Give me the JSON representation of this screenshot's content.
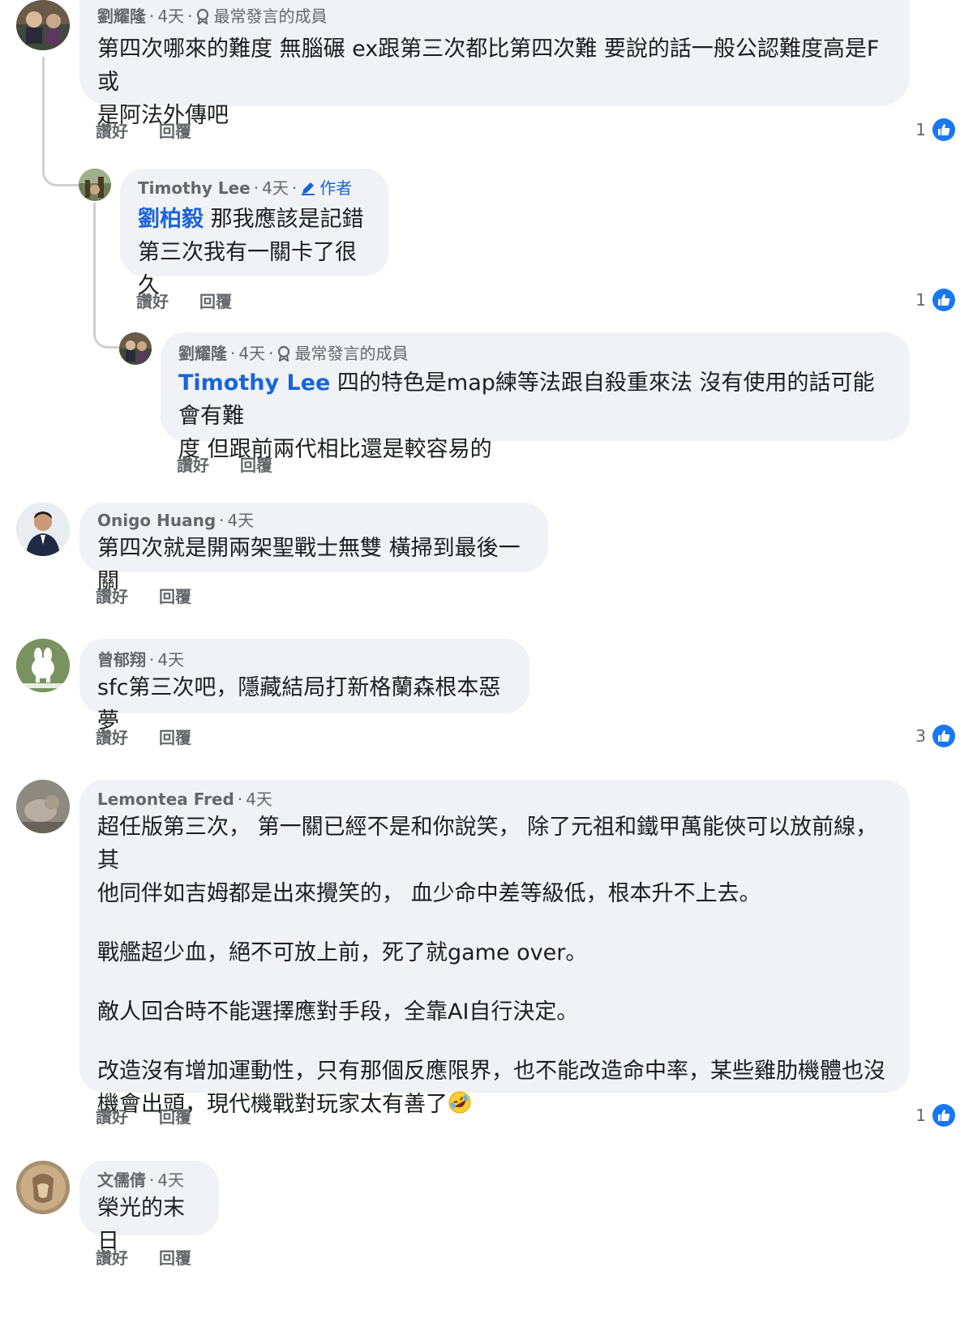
{
  "like_label": "讚好",
  "reply_label": "回覆",
  "comments": [
    {
      "name": "劉耀隆",
      "time": "4天",
      "badge": "最常發言的成員",
      "text_lines": [
        "第四次哪來的難度 無腦碾 ex跟第三次都比第四次難 要說的話一般公認難度高是F或",
        "是阿法外傳吧"
      ],
      "likes": "1"
    },
    {
      "name": "Timothy Lee",
      "time": "4天",
      "badge": "作者",
      "mention": "劉柏毅",
      "text_after_mention": " 那我應該是記錯",
      "text_line2": "第三次我有一關卡了很久",
      "likes": "1"
    },
    {
      "name": "劉耀隆",
      "time": "4天",
      "badge": "最常發言的成員",
      "mention": "Timothy Lee",
      "text_after_mention": " 四的特色是map練等法跟自殺重來法 沒有使用的話可能會有難",
      "text_line2": "度 但跟前兩代相比還是較容易的"
    },
    {
      "name": "Onigo Huang",
      "time": "4天",
      "text": "第四次就是開兩架聖戰士無雙 橫掃到最後一關"
    },
    {
      "name": "曾郁翔",
      "time": "4天",
      "text": "sfc第三次吧，隱藏結局打新格蘭森根本惡夢",
      "likes": "3"
    },
    {
      "name": "Lemontea Fred",
      "time": "4天",
      "paragraphs": [
        [
          "超任版第三次， 第一關已經不是和你說笑， 除了元祖和鐵甲萬能俠可以放前線， 其",
          "他同伴如吉姆都是出來攪笑的， 血少命中差等級低，根本升不上去。"
        ],
        [
          "戰艦超少血，絕不可放上前，死了就game over。"
        ],
        [
          "敵人回合時不能選擇應對手段，全靠AI自行決定。"
        ],
        [
          "改造沒有增加運動性，只有那個反應限界，也不能改造命中率，某些雞肋機體也沒",
          "機會出頭，現代機戰對玩家太有善了"
        ]
      ],
      "emoji": "rolling-on-floor-laughing-emoji",
      "likes": "1"
    },
    {
      "name": "文儒倩",
      "time": "4天",
      "text": "榮光的末日"
    }
  ],
  "icons": {
    "top_fan": "top-fan-badge-icon",
    "author": "author-pencil-icon",
    "like": "thumbs-up-icon"
  },
  "colors": {
    "bubble": "#f0f2f5",
    "mention": "#1a64d8",
    "like_blue": "#1877f2",
    "meta_gray": "#65676b"
  }
}
